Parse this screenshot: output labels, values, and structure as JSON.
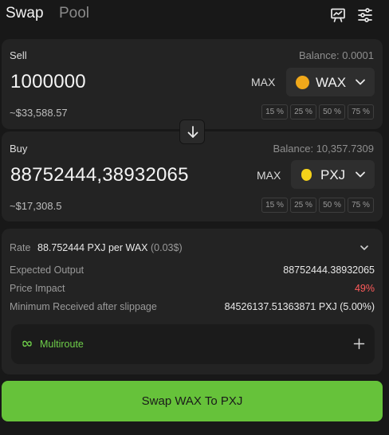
{
  "header": {
    "tabs": [
      {
        "label": "Swap",
        "active": true
      },
      {
        "label": "Pool",
        "active": false
      }
    ],
    "icons": [
      "chart-board-icon",
      "settings-sliders-icon"
    ]
  },
  "sell": {
    "label": "Sell",
    "balance_label": "Balance:",
    "balance_value": "0.0001",
    "amount": "1000000",
    "max_label": "MAX",
    "token": "WAX",
    "token_color": "#f0a81a",
    "usd_value": "~$33,588.57",
    "percent_buttons": [
      "15 %",
      "25 %",
      "50 %",
      "75 %"
    ]
  },
  "buy": {
    "label": "Buy",
    "balance_label": "Balance:",
    "balance_value": "10,357.7309",
    "amount": "88752444,38932065",
    "max_label": "MAX",
    "token": "PXJ",
    "token_color": "#f5d21a",
    "usd_value": "~$17,308.5",
    "percent_buttons": [
      "15 %",
      "25 %",
      "50 %",
      "75 %"
    ]
  },
  "details": {
    "rate_label": "Rate",
    "rate_text": "88.752444 PXJ per WAX",
    "rate_usd": "(0.03$)",
    "expected_output_label": "Expected Output",
    "expected_output_value": "88752444.38932065",
    "price_impact_label": "Price Impact",
    "price_impact_value": "49%",
    "min_received_label": "Minimum Received after slippage",
    "min_received_value": "84526137.51363871 PXJ (5.00%)",
    "multiroute_label": "Multiroute"
  },
  "swap_button_label": "Swap WAX To PXJ",
  "colors": {
    "accent_green": "#66c23a",
    "price_impact_red": "#ff5b5b",
    "multiroute_green": "#6fd04a"
  }
}
